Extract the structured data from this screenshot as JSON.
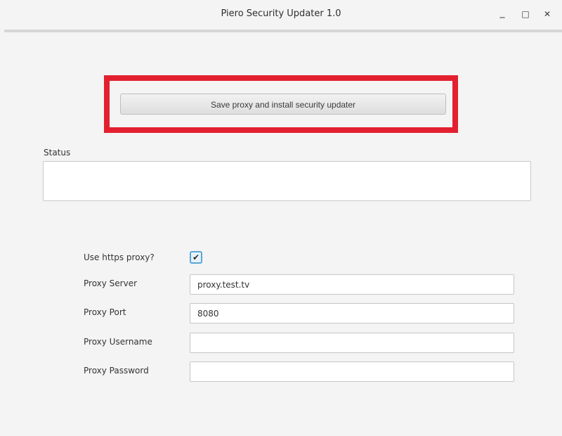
{
  "window": {
    "title": "Piero Security Updater 1.0",
    "controls": {
      "minimize": "_",
      "maximize": "□",
      "close": "✕"
    }
  },
  "main": {
    "install_button_label": "Save proxy and install security updater",
    "status_label": "Status",
    "status_value": ""
  },
  "proxy_form": {
    "use_https_label": "Use https proxy?",
    "use_https_checked": true,
    "checkbox_glyph": "✔",
    "server_label": "Proxy Server",
    "server_value": "proxy.test.tv",
    "port_label": "Proxy Port",
    "port_value": "8080",
    "username_label": "Proxy Username",
    "username_value": "",
    "password_label": "Proxy Password",
    "password_value": ""
  },
  "colors": {
    "highlight": "#e3202f",
    "checkbox_accent": "#5aa7d8",
    "window_background": "#f4f4f4"
  }
}
